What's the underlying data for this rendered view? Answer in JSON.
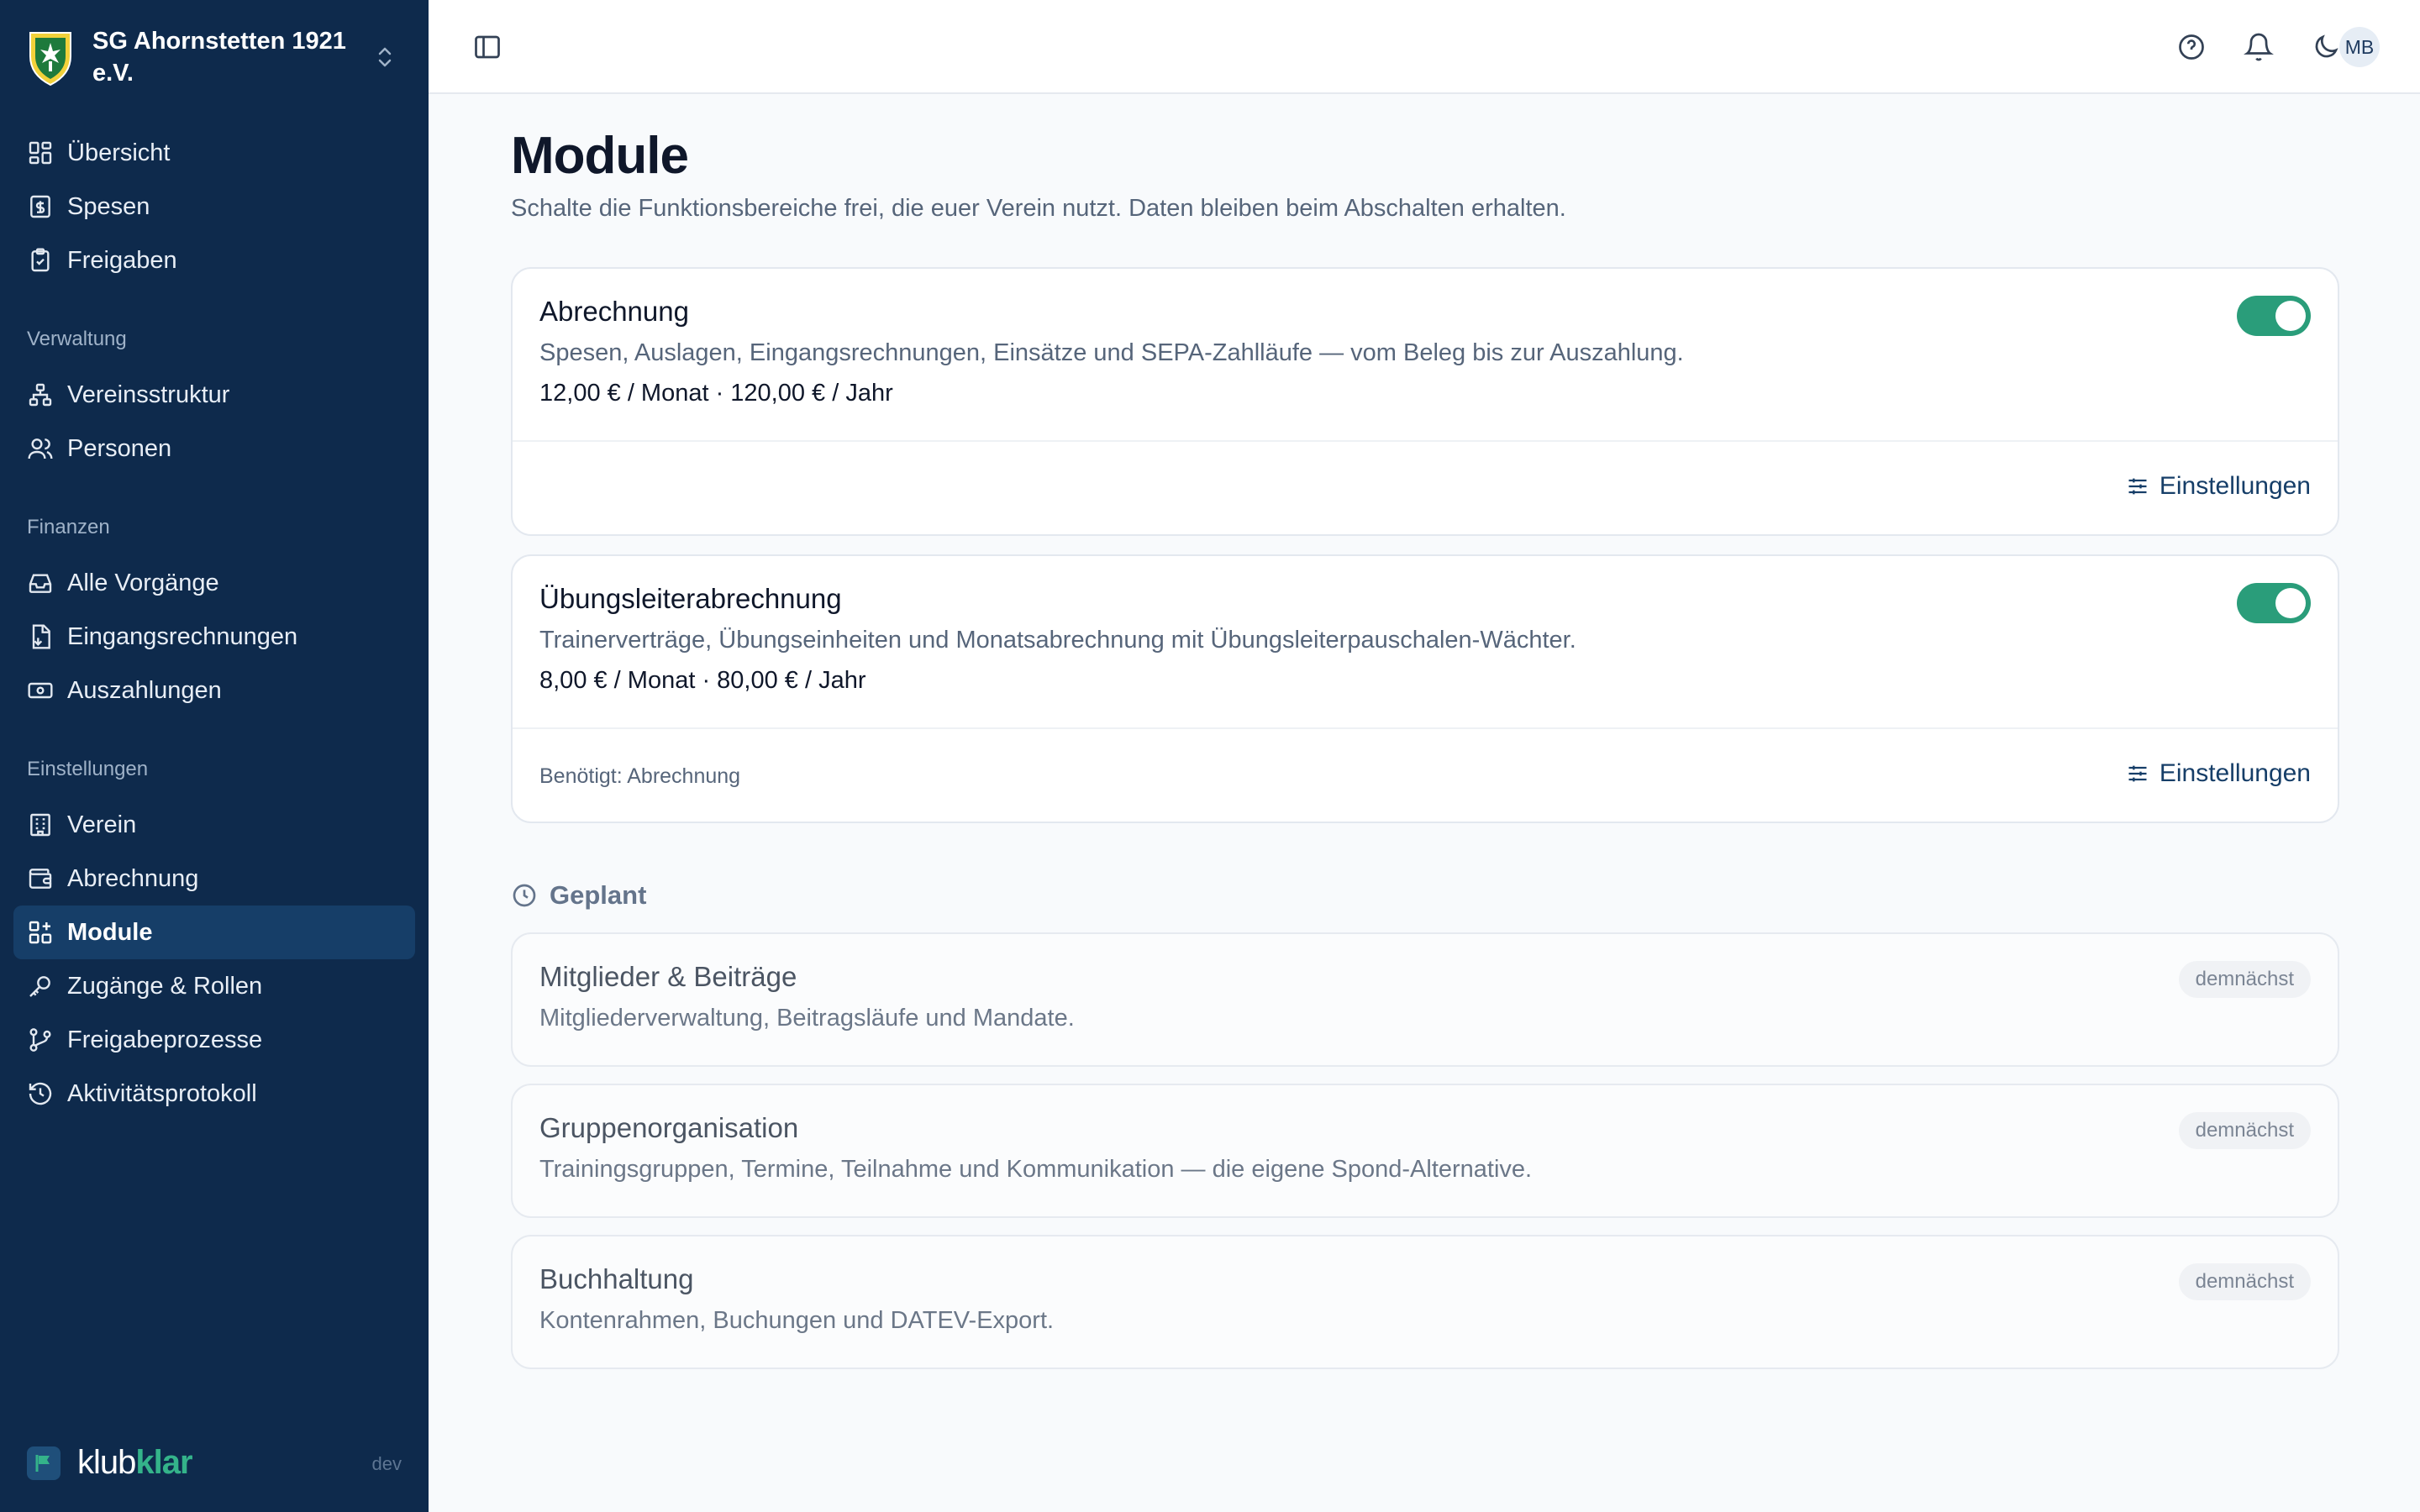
{
  "club": {
    "name": "SG Ahornstetten 1921 e.V."
  },
  "nav": {
    "top": [
      {
        "label": "Übersicht",
        "icon": "dashboard-icon"
      },
      {
        "label": "Spesen",
        "icon": "receipt-icon"
      },
      {
        "label": "Freigaben",
        "icon": "clipboard-check-icon"
      }
    ],
    "groups": [
      {
        "title": "Verwaltung",
        "items": [
          {
            "label": "Vereinsstruktur",
            "icon": "hierarchy-icon"
          },
          {
            "label": "Personen",
            "icon": "users-icon"
          }
        ]
      },
      {
        "title": "Finanzen",
        "items": [
          {
            "label": "Alle Vorgänge",
            "icon": "inbox-icon"
          },
          {
            "label": "Eingangsrechnungen",
            "icon": "invoice-icon"
          },
          {
            "label": "Auszahlungen",
            "icon": "banknote-icon"
          }
        ]
      },
      {
        "title": "Einstellungen",
        "items": [
          {
            "label": "Verein",
            "icon": "building-icon"
          },
          {
            "label": "Abrechnung",
            "icon": "wallet-icon"
          },
          {
            "label": "Module",
            "icon": "modules-icon",
            "active": true
          },
          {
            "label": "Zugänge & Rollen",
            "icon": "key-icon"
          },
          {
            "label": "Freigabeprozesse",
            "icon": "workflow-icon"
          },
          {
            "label": "Aktivitätsprotokoll",
            "icon": "history-icon"
          }
        ]
      }
    ]
  },
  "brand": {
    "part1": "klub",
    "part2": "klar",
    "env": "dev"
  },
  "topbar": {
    "avatar": "MB"
  },
  "page": {
    "title": "Module",
    "subtitle": "Schalte die Funktionsbereiche frei, die euer Verein nutzt. Daten bleiben beim Abschalten erhalten."
  },
  "modules": [
    {
      "title": "Abrechnung",
      "description": "Spesen, Auslagen, Eingangsrechnungen, Einsätze und SEPA-Zahlläufe — vom Beleg bis zur Auszahlung.",
      "price": "12,00 € / Monat · 120,00 € / Jahr",
      "enabled": true,
      "requires": "",
      "settings_label": "Einstellungen"
    },
    {
      "title": "Übungsleiterabrechnung",
      "description": "Trainerverträge, Übungseinheiten und Monatsabrechnung mit Übungsleiterpauschalen-Wächter.",
      "price": "8,00 € / Monat · 80,00 € / Jahr",
      "enabled": true,
      "requires": "Benötigt: Abrechnung",
      "settings_label": "Einstellungen"
    }
  ],
  "planned": {
    "heading": "Geplant",
    "items": [
      {
        "title": "Mitglieder & Beiträge",
        "description": "Mitgliederverwaltung, Beitragsläufe und Mandate.",
        "badge": "demnächst"
      },
      {
        "title": "Gruppenorganisation",
        "description": "Trainingsgruppen, Termine, Teilnahme und Kommunikation — die eigene Spond-Alternative.",
        "badge": "demnächst"
      },
      {
        "title": "Buchhaltung",
        "description": "Kontenrahmen, Buchungen und DATEV-Export.",
        "badge": "demnächst"
      }
    ]
  },
  "colors": {
    "sidebar": "#0e2a4c",
    "accent": "#2a9d7a",
    "active": "#163e68"
  }
}
